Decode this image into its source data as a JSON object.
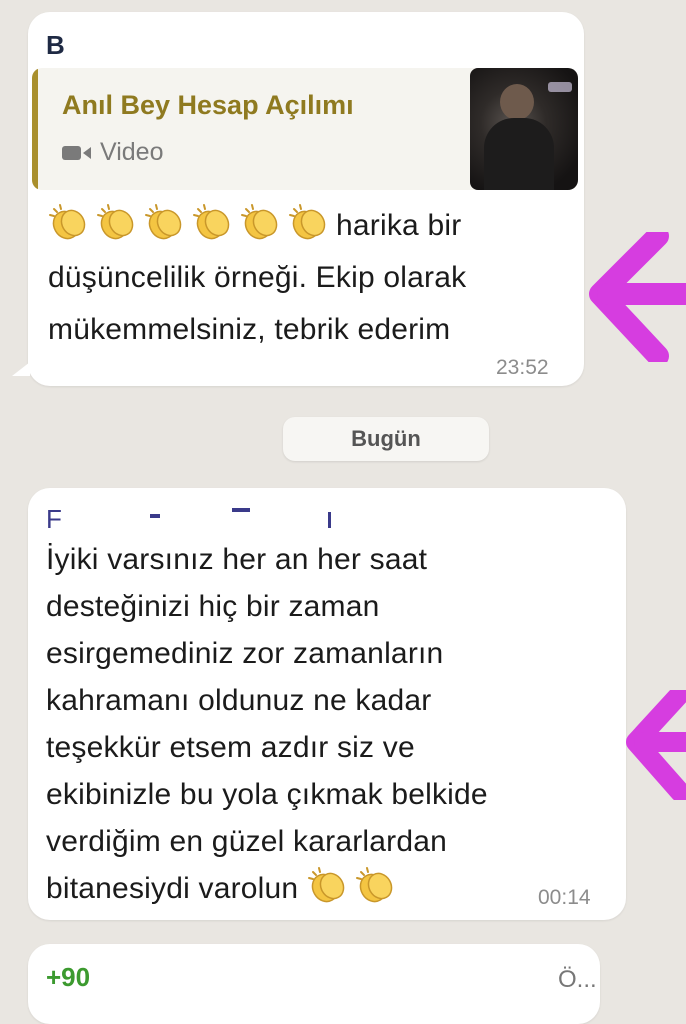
{
  "messages": [
    {
      "sender": "B",
      "sender_color": "#1f2a44",
      "quoted": {
        "title": "Anıl Bey Hesap Açılımı",
        "type_label": "Video"
      },
      "clap_count": 6,
      "lines": [
        "harika bir",
        "düşüncelilik örneği. Ekip olarak",
        "mükemmelsiniz, tebrik ederim"
      ],
      "time": "23:52"
    },
    {
      "sender": "F",
      "sender_color": "#3a3a8a",
      "lines": [
        "İyiki varsınız her an her saat",
        "desteğinizi hiç bir zaman",
        "esirgemediniz zor zamanların",
        "kahramanı oldunuz ne kadar",
        "teşekkür etsem azdır siz ve",
        "ekibinizle bu yola çıkmak belkide",
        "verdiğim en güzel kararlardan",
        "bitanesiydi varolun"
      ],
      "clap_count": 2,
      "time": "00:14"
    },
    {
      "sender": "+90",
      "sender_color": "#3c9a2f",
      "preview": "Ö..."
    }
  ],
  "date_separator": "Bugün",
  "colors": {
    "annotation_arrow": "#d63de0",
    "quote_accent": "#a98f2c"
  },
  "icons": [
    "video-camera-icon",
    "clapping-hands-icon",
    "annotation-arrow-icon"
  ]
}
